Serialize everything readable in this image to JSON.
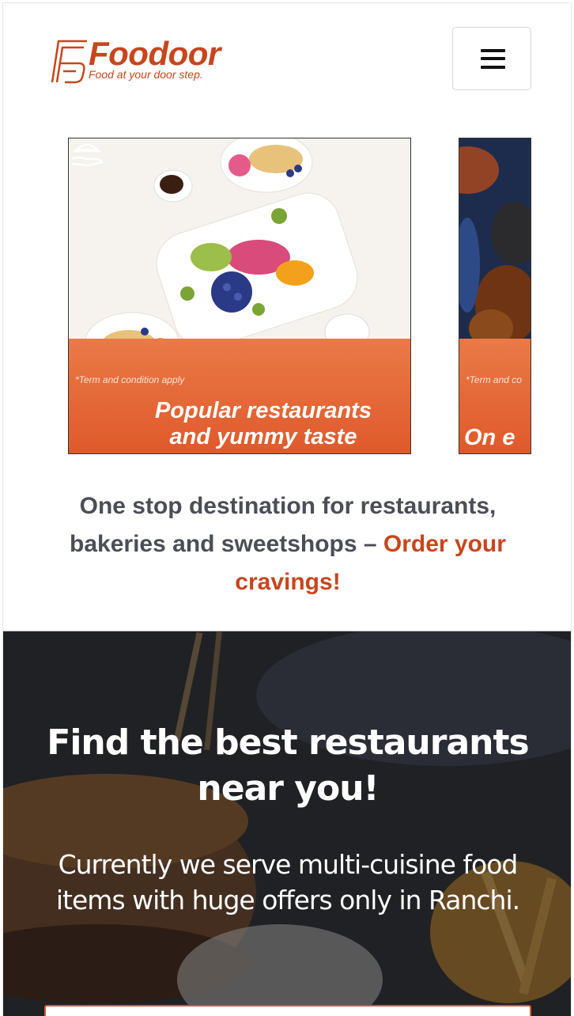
{
  "brand": {
    "name": "Foodoor",
    "tagline": "Food at your door step.",
    "color": "#c8461d"
  },
  "header": {
    "menu_icon": "hamburger-menu-icon"
  },
  "carousel": {
    "slides": [
      {
        "terms": "*Term and condition apply",
        "title": "Popular restaurants\nand yummy taste",
        "icon": "serving-hand-icon"
      },
      {
        "terms": "*Term and co",
        "title": "On e"
      }
    ]
  },
  "tagline": {
    "text": "One stop destination for restaurants, bakeries and sweetshops – ",
    "accent": "Order your cravings!"
  },
  "hero": {
    "title": "Find the best restaurants near you!",
    "text": "Currently we serve multi-cuisine food items with huge offers only in Ranchi."
  },
  "colors": {
    "accent": "#c8461d",
    "promo_orange": "#e0592b",
    "text_dark": "#4b4e56"
  }
}
